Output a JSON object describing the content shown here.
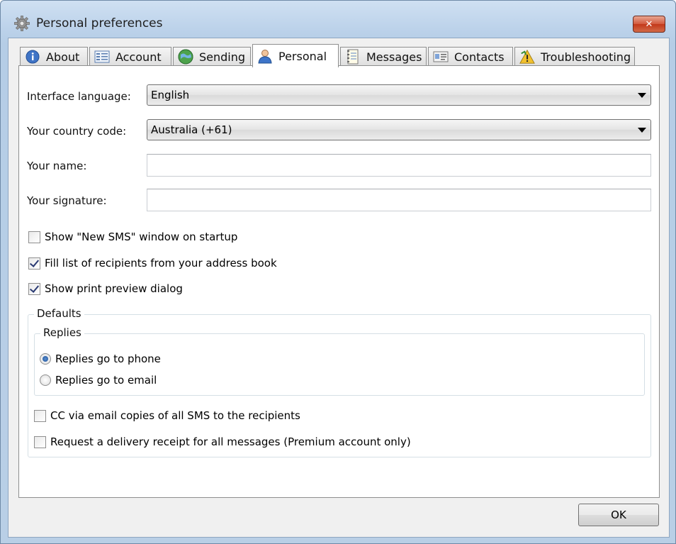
{
  "window": {
    "title": "Personal preferences",
    "close_symbol": "✕"
  },
  "tabs": [
    {
      "label": "About",
      "icon": "info-icon"
    },
    {
      "label": "Account",
      "icon": "account-card-icon"
    },
    {
      "label": "Sending",
      "icon": "globe-icon"
    },
    {
      "label": "Personal",
      "icon": "person-icon",
      "active": true
    },
    {
      "label": "Messages",
      "icon": "notepad-icon"
    },
    {
      "label": "Contacts",
      "icon": "contact-card-icon"
    },
    {
      "label": "Troubleshooting",
      "icon": "warning-icon"
    }
  ],
  "form": {
    "language_label": "Interface language:",
    "language_value": "English",
    "country_label": "Your country code:",
    "country_value": "Australia (+61)",
    "name_label": "Your name:",
    "name_value": "",
    "signature_label": "Your signature:",
    "signature_value": ""
  },
  "options": [
    {
      "label": "Show \"New SMS\" window on startup",
      "checked": false
    },
    {
      "label": "Fill list of recipients from your address book",
      "checked": true
    },
    {
      "label": "Show print preview dialog",
      "checked": true
    }
  ],
  "defaults": {
    "title": "Defaults",
    "replies_title": "Replies",
    "replies": [
      {
        "label": "Replies go to phone",
        "selected": true
      },
      {
        "label": "Replies go to email",
        "selected": false
      }
    ],
    "cc_label": "CC via email copies of all SMS to the recipients",
    "cc_checked": false,
    "receipt_label": "Request a delivery receipt for all messages (Premium account only)",
    "receipt_checked": false
  },
  "buttons": {
    "ok": "OK"
  }
}
